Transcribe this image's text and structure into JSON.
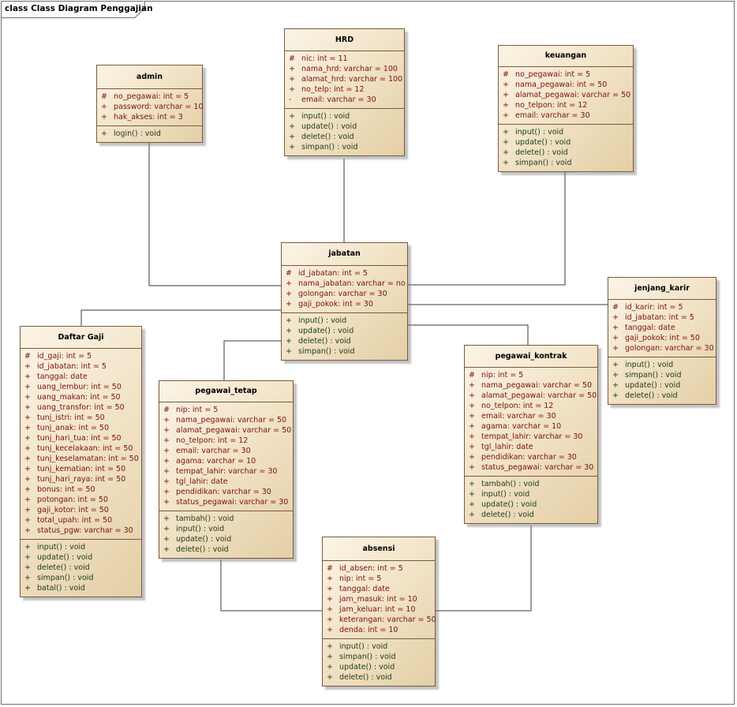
{
  "frame": {
    "title": "class Class Diagram Penggajian"
  },
  "classes": {
    "admin": {
      "name": "admin",
      "attributes": [
        {
          "vis": "#",
          "text": "no_pegawai:  int = 5"
        },
        {
          "vis": "+",
          "text": "password:  varchar = 10"
        },
        {
          "vis": "+",
          "text": "hak_akses:  int = 3"
        }
      ],
      "operations": [
        {
          "vis": "+",
          "text": "login() : void"
        }
      ]
    },
    "hrd": {
      "name": "HRD",
      "attributes": [
        {
          "vis": "#",
          "text": "nic:  int = 11"
        },
        {
          "vis": "+",
          "text": "nama_hrd:  varchar = 100"
        },
        {
          "vis": "+",
          "text": "alamat_hrd:  varchar = 100"
        },
        {
          "vis": "+",
          "text": "no_telp:  int = 12"
        },
        {
          "vis": "-",
          "text": "email:  varchar = 30"
        }
      ],
      "operations": [
        {
          "vis": "+",
          "text": "input() : void"
        },
        {
          "vis": "+",
          "text": "update() : void"
        },
        {
          "vis": "+",
          "text": "delete() : void"
        },
        {
          "vis": "+",
          "text": "simpan() : void"
        }
      ]
    },
    "keuangan": {
      "name": "keuangan",
      "attributes": [
        {
          "vis": "#",
          "text": "no_pegawai:  int = 5"
        },
        {
          "vis": "+",
          "text": "nama_pegawai:  int = 50"
        },
        {
          "vis": "+",
          "text": "alamat_pegawai:  varchar = 50"
        },
        {
          "vis": "+",
          "text": "no_telpon:  int = 12"
        },
        {
          "vis": "+",
          "text": "email:  varchar = 30"
        }
      ],
      "operations": [
        {
          "vis": "+",
          "text": "input() : void"
        },
        {
          "vis": "+",
          "text": "update() : void"
        },
        {
          "vis": "+",
          "text": "delete() : void"
        },
        {
          "vis": "+",
          "text": "simpan() : void"
        }
      ]
    },
    "jabatan": {
      "name": "jabatan",
      "attributes": [
        {
          "vis": "#",
          "text": "id_jabatan:  int = 5"
        },
        {
          "vis": "+",
          "text": "nama_jabatan:  varchar = no"
        },
        {
          "vis": "+",
          "text": "golongan:  varchar = 30"
        },
        {
          "vis": "+",
          "text": "gaji_pokok:  int = 30"
        }
      ],
      "operations": [
        {
          "vis": "+",
          "text": "input() : void"
        },
        {
          "vis": "+",
          "text": "update() : void"
        },
        {
          "vis": "+",
          "text": "delete() : void"
        },
        {
          "vis": "+",
          "text": "simpan() : void"
        }
      ]
    },
    "jenjang_karir": {
      "name": "jenjang_karir",
      "attributes": [
        {
          "vis": "#",
          "text": "id_karir:  int = 5"
        },
        {
          "vis": "+",
          "text": "id_jabatan:  int = 5"
        },
        {
          "vis": "+",
          "text": "tanggal:  date"
        },
        {
          "vis": "+",
          "text": "gaji_pokok:  int = 50"
        },
        {
          "vis": "+",
          "text": "golongan:  varchar = 30"
        }
      ],
      "operations": [
        {
          "vis": "+",
          "text": "input() : void"
        },
        {
          "vis": "+",
          "text": "simpan() : void"
        },
        {
          "vis": "+",
          "text": "update() : void"
        },
        {
          "vis": "+",
          "text": "delete() : void"
        }
      ]
    },
    "daftar_gaji": {
      "name": "Daftar Gaji",
      "attributes": [
        {
          "vis": "#",
          "text": "id_gaji:  int = 5"
        },
        {
          "vis": "+",
          "text": "id_jabatan:  int = 5"
        },
        {
          "vis": "+",
          "text": "tanggal:  date"
        },
        {
          "vis": "+",
          "text": "uang_lembur:  int = 50"
        },
        {
          "vis": "+",
          "text": "uang_makan:  int = 50"
        },
        {
          "vis": "+",
          "text": "uang_transfor:  int = 50"
        },
        {
          "vis": "+",
          "text": "tunj_istri:  int = 50"
        },
        {
          "vis": "+",
          "text": "tunj_anak:  int = 50"
        },
        {
          "vis": "+",
          "text": "tunj_hari_tua:  int = 50"
        },
        {
          "vis": "+",
          "text": "tunj_kecelakaan:  int = 50"
        },
        {
          "vis": "+",
          "text": "tunj_keselamatan:  int = 50"
        },
        {
          "vis": "+",
          "text": "tunj_kematian:  int = 50"
        },
        {
          "vis": "+",
          "text": "tunj_hari_raya:  int = 50"
        },
        {
          "vis": "+",
          "text": "bonus:  int = 50"
        },
        {
          "vis": "+",
          "text": "potongan:  int = 50"
        },
        {
          "vis": "+",
          "text": "gaji_kotor:  int = 50"
        },
        {
          "vis": "+",
          "text": "total_upah:  int = 50"
        },
        {
          "vis": "+",
          "text": "status_pgw:  varchar = 30"
        }
      ],
      "operations": [
        {
          "vis": "+",
          "text": "input() : void"
        },
        {
          "vis": "+",
          "text": "update() : void"
        },
        {
          "vis": "+",
          "text": "delete() : void"
        },
        {
          "vis": "+",
          "text": "simpan() : void"
        },
        {
          "vis": "+",
          "text": "batal() : void"
        }
      ]
    },
    "pegawai_tetap": {
      "name": "pegawai_tetap",
      "attributes": [
        {
          "vis": "#",
          "text": "nip:  int = 5"
        },
        {
          "vis": "+",
          "text": "nama_pegawai:  varchar = 50"
        },
        {
          "vis": "+",
          "text": "alamat_pegawai:  varchar = 50"
        },
        {
          "vis": "+",
          "text": "no_telpon:  int = 12"
        },
        {
          "vis": "+",
          "text": "email:  varchar = 30"
        },
        {
          "vis": "+",
          "text": "agama:  varchar = 10"
        },
        {
          "vis": "+",
          "text": "tempat_lahir:  varchar = 30"
        },
        {
          "vis": "+",
          "text": "tgl_lahir:  date"
        },
        {
          "vis": "+",
          "text": "pendidikan:  varchar = 30"
        },
        {
          "vis": "+",
          "text": "status_pegawai:  varchar = 30"
        }
      ],
      "operations": [
        {
          "vis": "+",
          "text": "tambah() : void"
        },
        {
          "vis": "+",
          "text": "input() : void"
        },
        {
          "vis": "+",
          "text": "update() : void"
        },
        {
          "vis": "+",
          "text": "delete() : void"
        }
      ]
    },
    "pegawai_kontrak": {
      "name": "pegawai_kontrak",
      "attributes": [
        {
          "vis": "#",
          "text": "nip:  int = 5"
        },
        {
          "vis": "+",
          "text": "nama_pegawai:  varchar = 50"
        },
        {
          "vis": "+",
          "text": "alamat_pegawai:  varchar = 50"
        },
        {
          "vis": "+",
          "text": "no_telpon:  int = 12"
        },
        {
          "vis": "+",
          "text": "email:  varchar = 30"
        },
        {
          "vis": "+",
          "text": "agama:  varchar = 10"
        },
        {
          "vis": "+",
          "text": "tempat_lahir:  varchar = 30"
        },
        {
          "vis": "+",
          "text": "tgl_lahir:  date"
        },
        {
          "vis": "+",
          "text": "pendidikan:  varchar = 30"
        },
        {
          "vis": "+",
          "text": "status_pegawai:  varchar = 30"
        }
      ],
      "operations": [
        {
          "vis": "+",
          "text": "tambah() : void"
        },
        {
          "vis": "+",
          "text": "input() : void"
        },
        {
          "vis": "+",
          "text": "update() : void"
        },
        {
          "vis": "+",
          "text": "delete() : void"
        }
      ]
    },
    "absensi": {
      "name": "absensi",
      "attributes": [
        {
          "vis": "#",
          "text": "id_absen:  int = 5"
        },
        {
          "vis": "+",
          "text": "nip:  int = 5"
        },
        {
          "vis": "+",
          "text": "tanggal:  date"
        },
        {
          "vis": "+",
          "text": "jam_masuk:  int = 10"
        },
        {
          "vis": "+",
          "text": "jam_keluar:  int = 10"
        },
        {
          "vis": "+",
          "text": "keterangan:  varchar = 50"
        },
        {
          "vis": "+",
          "text": "denda:  int = 10"
        }
      ],
      "operations": [
        {
          "vis": "+",
          "text": "input() : void"
        },
        {
          "vis": "+",
          "text": "simpan() : void"
        },
        {
          "vis": "+",
          "text": "update() : void"
        },
        {
          "vis": "+",
          "text": "delete() : void"
        }
      ]
    }
  }
}
